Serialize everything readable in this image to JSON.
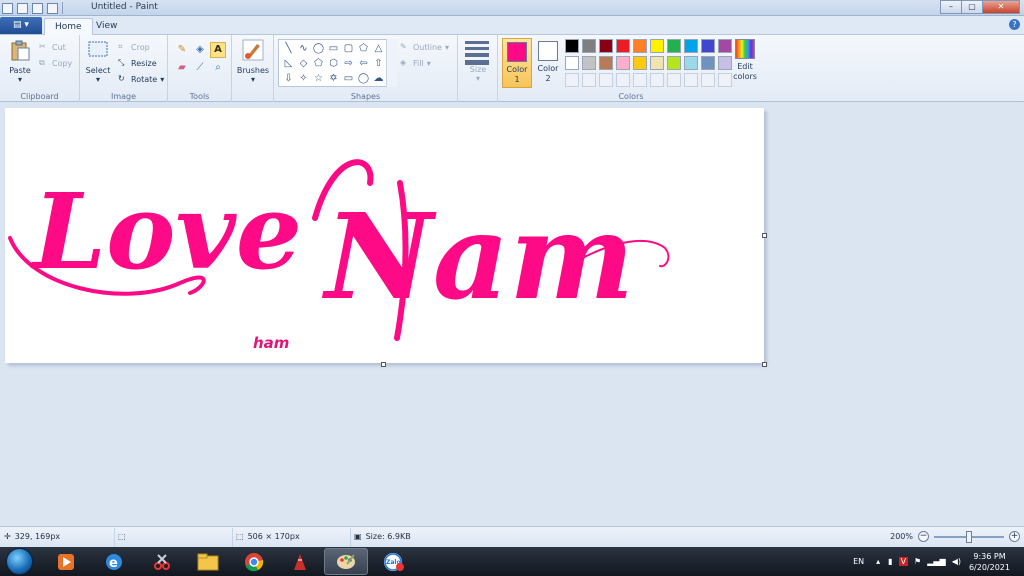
{
  "window": {
    "title": "Untitled - Paint",
    "minimize": "–",
    "maximize": "▢",
    "close": "✕"
  },
  "tabs": {
    "home": "Home",
    "view": "View",
    "help": "?"
  },
  "clipboard": {
    "paste": "Paste",
    "cut": "Cut",
    "copy": "Copy",
    "label": "Clipboard"
  },
  "image": {
    "select": "Select",
    "crop": "Crop",
    "resize": "Resize",
    "rotate": "Rotate",
    "label": "Image"
  },
  "tools": {
    "label": "Tools",
    "text_tool": "A"
  },
  "brushes": {
    "label": "Brushes"
  },
  "shapes": {
    "outline": "Outline",
    "fill": "Fill",
    "label": "Shapes"
  },
  "size": {
    "label": "Size"
  },
  "colors": {
    "color1_label": "Color",
    "color1_num": "1",
    "color2_label": "Color",
    "color2_num": "2",
    "color1": "#ff0a86",
    "color2": "#ffffff",
    "edit_label": "Edit",
    "edit_label2": "colors",
    "group_label": "Colors",
    "palette": [
      "#000000",
      "#7f7f7f",
      "#880015",
      "#ed1c24",
      "#ff7f27",
      "#fff200",
      "#22b14c",
      "#00a2e8",
      "#3f48cc",
      "#a349a4",
      "#ffffff",
      "#c3c3c3",
      "#b97a57",
      "#ffaec9",
      "#ffc90e",
      "#efe4b0",
      "#b5e61d",
      "#99d9ea",
      "#7092be",
      "#c8bfe7"
    ]
  },
  "canvas": {
    "text_love": "Love",
    "text_nam": "Nam",
    "text_ham": "ham",
    "ink_color": "#ff0a86"
  },
  "status": {
    "cursor_pos": "329, 169px",
    "dimensions": "506 × 170px",
    "file_size": "Size: 6.9KB",
    "zoom": "200%"
  },
  "tray": {
    "lang": "EN",
    "time": "9:36 PM",
    "date": "6/20/2021"
  }
}
